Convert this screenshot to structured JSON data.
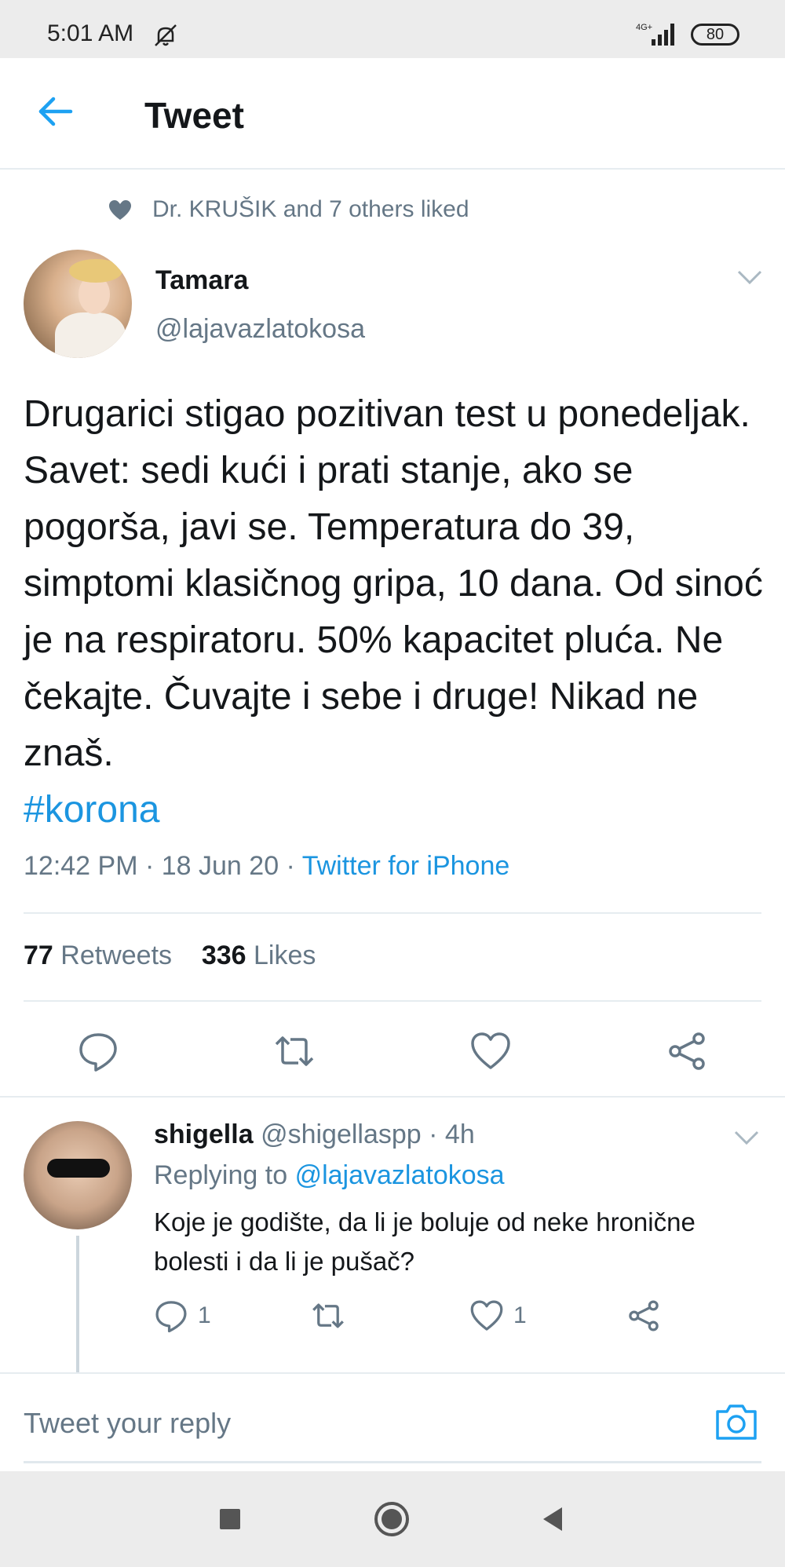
{
  "status_bar": {
    "time": "5:01 AM",
    "network": "4G+",
    "battery": "80"
  },
  "header": {
    "title": "Tweet"
  },
  "social_context": {
    "text": "Dr. KRUŠIK and 7 others liked"
  },
  "tweet": {
    "author_name": "Tamara",
    "author_handle": "@lajavazlatokosa",
    "text": "Drugarici stigao pozitivan test u ponedeljak. Savet: sedi kući i prati stanje, ako se pogorša, javi se. Temperatura do 39, simptomi klasičnog gripa, 10 dana. Od sinoć je na respiratoru. 50% kapacitet pluća. Ne čekajte. Čuvajte i sebe i druge! Nikad ne znaš.",
    "hashtag": "#korona",
    "time": "12:42 PM",
    "date": "18 Jun 20",
    "source": "Twitter for iPhone",
    "retweets_count": "77",
    "retweets_label": "Retweets",
    "likes_count": "336",
    "likes_label": "Likes"
  },
  "reply": {
    "author_name": "shigella",
    "author_handle": "@shigellaspp",
    "age": "4h",
    "replying_prefix": "Replying to",
    "replying_to": "@lajavazlatokosa",
    "text": "Koje je godište, da li je boluje od neke hronične bolesti i da li je pušač?",
    "reply_count": "1",
    "like_count": "1"
  },
  "compose": {
    "placeholder": "Tweet your reply"
  },
  "colors": {
    "accent": "#1b95e0",
    "secondary_text": "#657786",
    "primary_text": "#14171a",
    "divider": "#e6ecf0"
  },
  "icons": [
    "back-arrow-icon",
    "heart-icon",
    "chevron-down-icon",
    "reply-icon",
    "retweet-icon",
    "like-icon",
    "share-icon",
    "camera-icon",
    "recents-icon",
    "home-icon",
    "back-icon"
  ]
}
